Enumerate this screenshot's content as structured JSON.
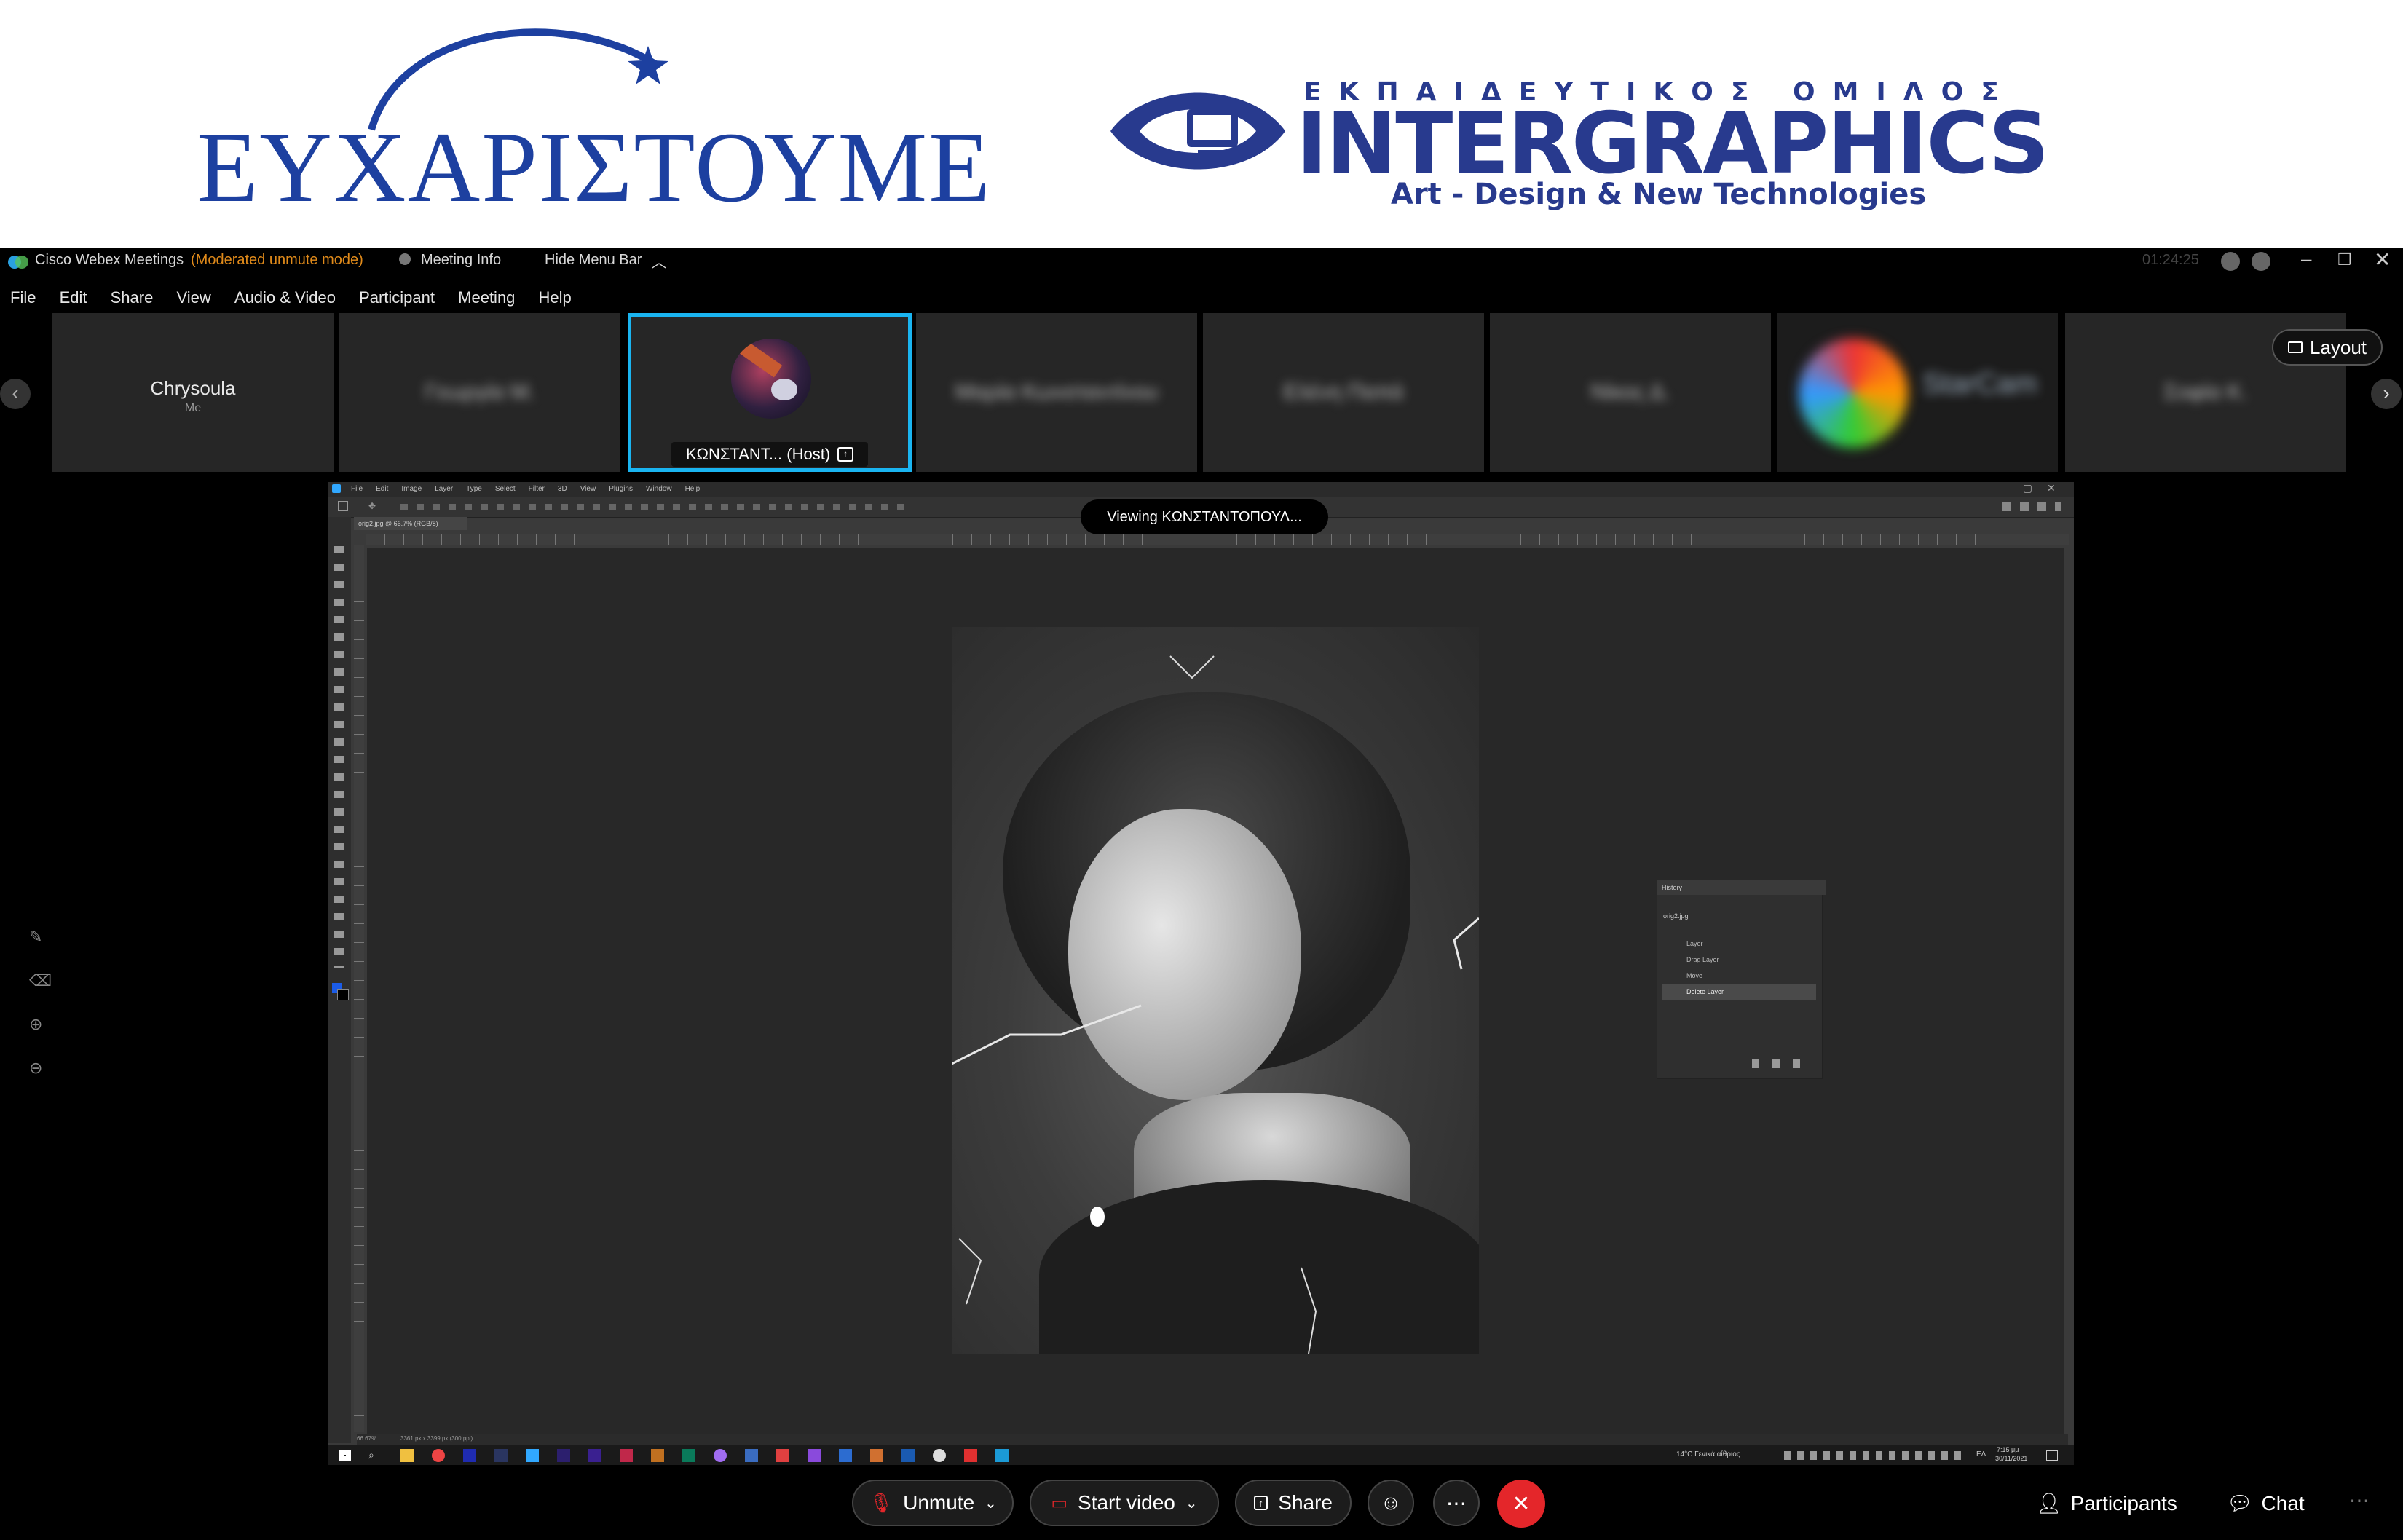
{
  "banner": {
    "thanks_text": "ΕΥΧΑΡΙΣΤΟΥΜΕ",
    "logo_group": "ΕΚΠΑΙΔΕΥΤΙΚΟΣ ΟΜΙΛΟΣ",
    "logo_name": "INTERGRAPHICS",
    "logo_tagline": "Art - Design & New Technologies",
    "brand_color": "#283a8e"
  },
  "window": {
    "app_title": "Cisco Webex Meetings",
    "mode_note": "(Moderated unmute mode)",
    "meeting_info": "Meeting Info",
    "hide_menu": "Hide Menu Bar",
    "timer": "01:24:25"
  },
  "menu": [
    "File",
    "Edit",
    "Share",
    "View",
    "Audio & Video",
    "Participant",
    "Meeting",
    "Help"
  ],
  "participants_strip": {
    "me_name": "Chrysoula",
    "me_sub": "Me",
    "host_label": "ΚΩΝΣΤΑΝΤ...  (Host)",
    "layout_label": "Layout",
    "blurred_names": [
      "Γεωργία Μ.",
      "Μαρία Κωνσταντίνου",
      "Ελένη Παπά",
      "Νίκος Δ.",
      "StarCam",
      "Σοφία Κ."
    ]
  },
  "shared_screen": {
    "viewing_label": "Viewing ΚΩΝΣΤΑΝΤΟΠΟΥΛ...",
    "ps_menu": [
      "File",
      "Edit",
      "Image",
      "Layer",
      "Type",
      "Select",
      "Filter",
      "3D",
      "View",
      "Plugins",
      "Window",
      "Help"
    ],
    "doc_tab": "orig2.jpg @ 66.7% (RGB/8)",
    "history_title": "History",
    "history_snapshot": "orig2.jpg",
    "history_items": [
      "Layer",
      "Drag Layer",
      "Move",
      "Delete Layer"
    ],
    "status_zoom": "66.67%",
    "status_info": "3361 px x 3399 px (300 ppi)",
    "weather": "14°C  Γενικά αίθριος",
    "tray_lang": "ΕΛ",
    "clock_time": "7:15 μμ",
    "clock_date": "30/11/2021"
  },
  "controls": {
    "unmute": "Unmute",
    "start_video": "Start video",
    "share": "Share",
    "participants": "Participants",
    "chat": "Chat"
  },
  "colors": {
    "host_border": "#1ab4f0",
    "end_call": "#e4262a",
    "mode_note": "#e08a1a"
  }
}
